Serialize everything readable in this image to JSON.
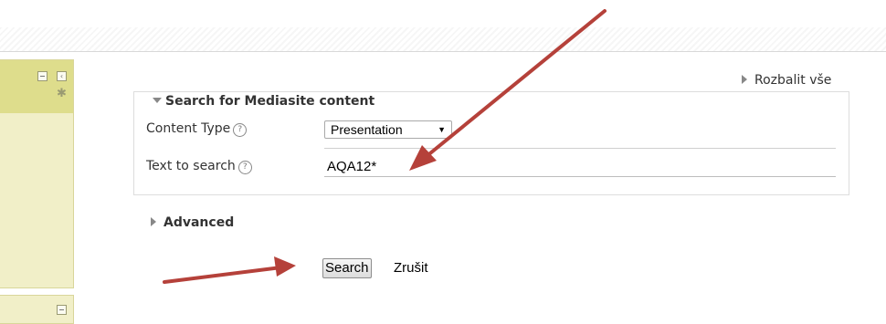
{
  "expand_all_label": "Rozbalit vše",
  "search_section": {
    "legend": "Search for Mediasite content",
    "content_type_label": "Content Type",
    "content_type_value": "Presentation",
    "text_to_search_label": "Text to search",
    "text_to_search_value": "AQA12*"
  },
  "advanced_label": "Advanced",
  "buttons": {
    "search": "Search",
    "cancel": "Zrušit"
  },
  "help_glyph": "?",
  "colors": {
    "sidebar_header": "#dedd8c",
    "sidebar_body": "#f1efc8",
    "annotation_arrow": "#b5413a"
  }
}
